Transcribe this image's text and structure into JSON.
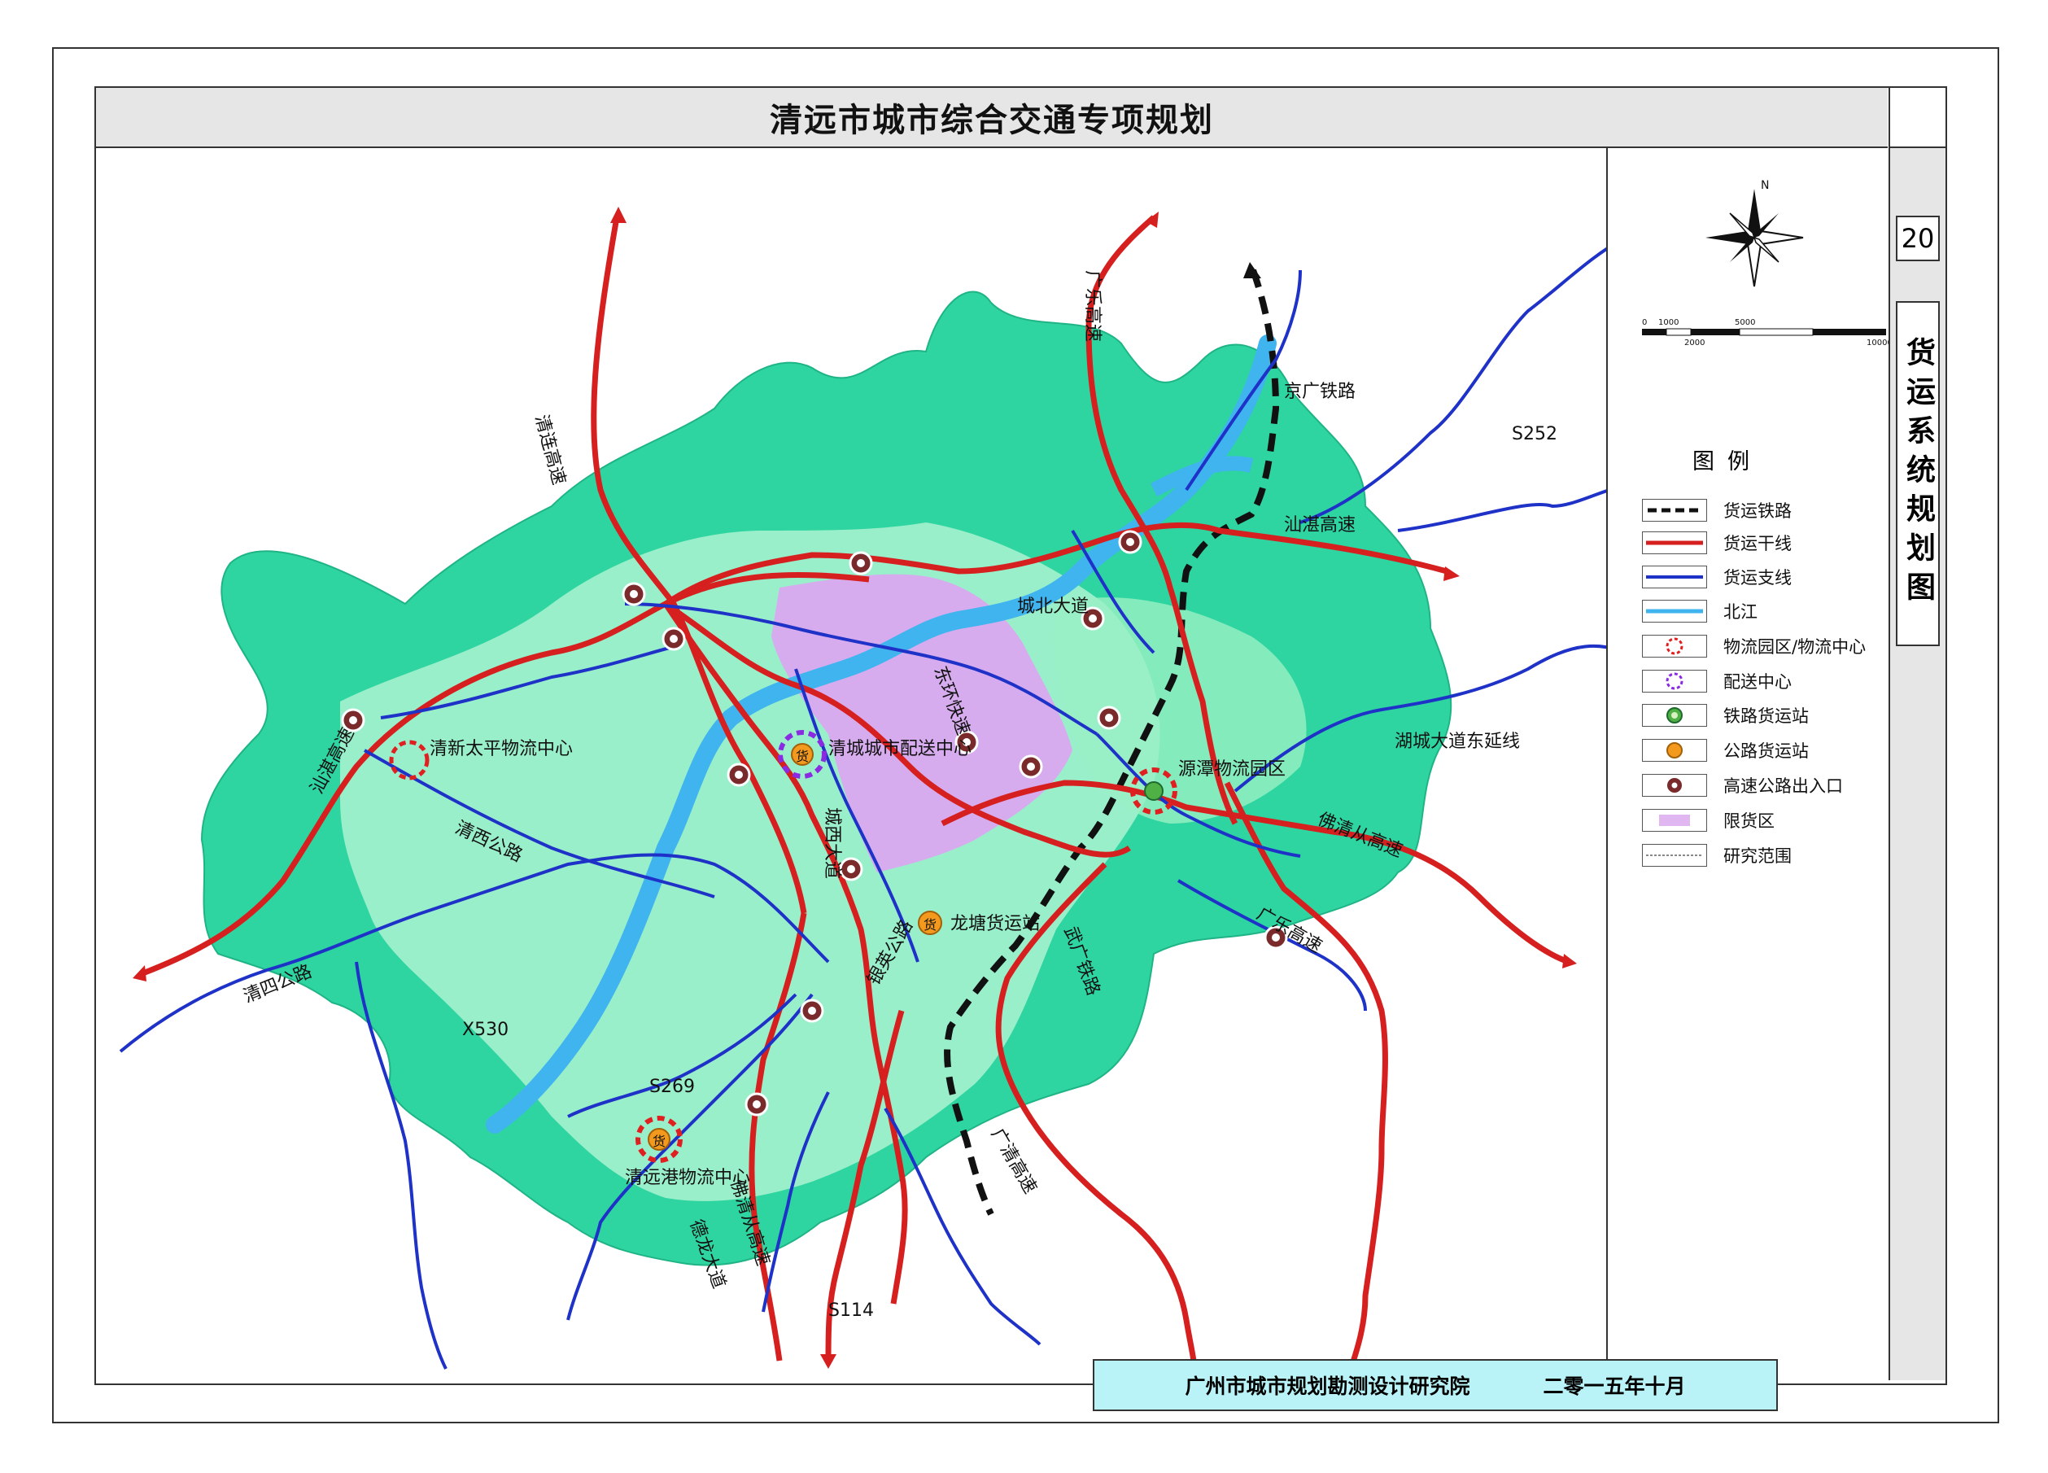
{
  "header": {
    "title": "清远市城市综合交通专项规划"
  },
  "sidebar": {
    "map_number": "20",
    "map_title": "货运系统规划图"
  },
  "footer": {
    "institute": "广州市城市规划勘测设计研究院",
    "date": "二零一五年十月"
  },
  "scalebar": {
    "ticks": [
      "0",
      "1000",
      "2000",
      "5000",
      "10000m"
    ]
  },
  "compass": {
    "north": "N"
  },
  "legend": {
    "title": "图例",
    "items": [
      {
        "label": "货运铁路",
        "symbol": "freight-railway-line",
        "color": "#111111"
      },
      {
        "label": "货运干线",
        "symbol": "freight-trunk-line",
        "color": "#d61f1f"
      },
      {
        "label": "货运支线",
        "symbol": "freight-branch-line",
        "color": "#1f32c8"
      },
      {
        "label": "北江",
        "symbol": "river-line",
        "color": "#3fb4ee"
      },
      {
        "label": "物流园区/物流中心",
        "symbol": "logistics-park-icon",
        "color": "#e02020"
      },
      {
        "label": "配送中心",
        "symbol": "distribution-center-icon",
        "color": "#8a2be2"
      },
      {
        "label": "铁路货运站",
        "symbol": "railway-freight-station-icon",
        "color": "#2e8b3a"
      },
      {
        "label": "公路货运站",
        "symbol": "road-freight-station-icon",
        "color": "#f39a1e"
      },
      {
        "label": "高速公路出入口",
        "symbol": "expressway-interchange-icon",
        "color": "#7a2a2a"
      },
      {
        "label": "限货区",
        "symbol": "restricted-zone-swatch",
        "color": "#e0b7f0"
      },
      {
        "label": "研究范围",
        "symbol": "study-boundary-line",
        "color": "#888888"
      }
    ]
  },
  "map": {
    "colors": {
      "region": "#2fd5a0",
      "urban": "#a6f2cf",
      "restricted": "#d9a8ef",
      "river": "#3fb4ee",
      "trunk": "#d61f1f",
      "branch": "#1f32c8",
      "railway": "#111111"
    },
    "road_labels": {
      "qinglian": "清连高速",
      "guangle_north": "广乐高速",
      "jingguang": "京广铁路",
      "s252": "S252",
      "shanzhan_east": "汕湛高速",
      "chengbei": "城北大道",
      "donghuan": "东环快速",
      "shanzhan_west": "汕湛高速",
      "qingxi": "清西公路",
      "qingsi": "清四公路",
      "x530": "X530",
      "chengxi": "城西大道",
      "yinying": "银英公路",
      "s269": "S269",
      "hucheng": "湖城大道东延线",
      "foqingcong_east": "佛清从高速",
      "guangle_south": "广乐高速",
      "guangqing": "广清高速",
      "railway_south": "武广铁路",
      "delong": "德龙大道",
      "foqingcong_south": "佛清从高速",
      "s114": "S114"
    },
    "facility_labels": {
      "qingxin_taiping": "清新太平物流中心",
      "qingcheng_dist": "清城城市配送中心",
      "yuantan": "源潭物流园区",
      "longtang": "龙塘货运站",
      "qingyuan_port": "清远港物流中心"
    },
    "badge_text": "货"
  }
}
